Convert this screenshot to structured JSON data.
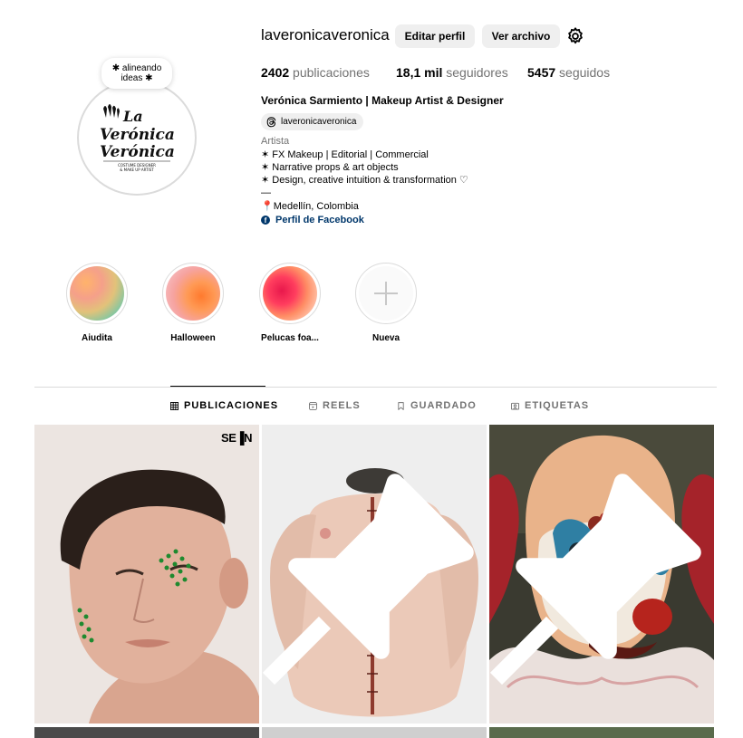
{
  "profile": {
    "username": "laveronicaveronica",
    "edit_button": "Editar perfil",
    "archive_button": "Ver archivo",
    "note_line1": "✱ alineando",
    "note_line2": "ideas ✱",
    "avatar_logo_line1": "La",
    "avatar_logo_line2": "Verónica",
    "avatar_logo_line3": "Verónica",
    "avatar_logo_sub1": "COSTUME DESIGNER",
    "avatar_logo_sub2": "& MAKE UP ARTIST"
  },
  "stats": {
    "posts_count": "2402",
    "posts_label": "publicaciones",
    "followers_count": "18,1 mil",
    "followers_label": "seguidores",
    "following_count": "5457",
    "following_label": "seguidos"
  },
  "bio": {
    "full_name": "Verónica Sarmiento | Makeup Artist & Designer",
    "threads_handle": "laveronicaveronica",
    "category": "Artista",
    "lines": [
      "✶ FX Makeup | Editorial | Commercial",
      "✶ Narrative props & art objects",
      "✶ Design, creative intuition & transformation ♡",
      "—",
      "📍Medellín, Colombia"
    ],
    "facebook_link": "Perfil de Facebook"
  },
  "highlights": [
    {
      "label": "Aiudita"
    },
    {
      "label": "Halloween"
    },
    {
      "label": "Pelucas foa..."
    },
    {
      "label": "Nueva"
    }
  ],
  "tabs": [
    {
      "label": "PUBLICACIONES",
      "icon": "grid-icon",
      "active": true
    },
    {
      "label": "REELS",
      "icon": "reels-icon",
      "active": false
    },
    {
      "label": "GUARDADO",
      "icon": "bookmark-icon",
      "active": false
    },
    {
      "label": "ETIQUETAS",
      "icon": "tag-icon",
      "active": false
    }
  ],
  "posts": {
    "badge_text": "SE▐N"
  },
  "colors": {
    "link": "#00376b",
    "muted": "#737373",
    "button_bg": "#efefef",
    "border": "#dbdbdb"
  }
}
